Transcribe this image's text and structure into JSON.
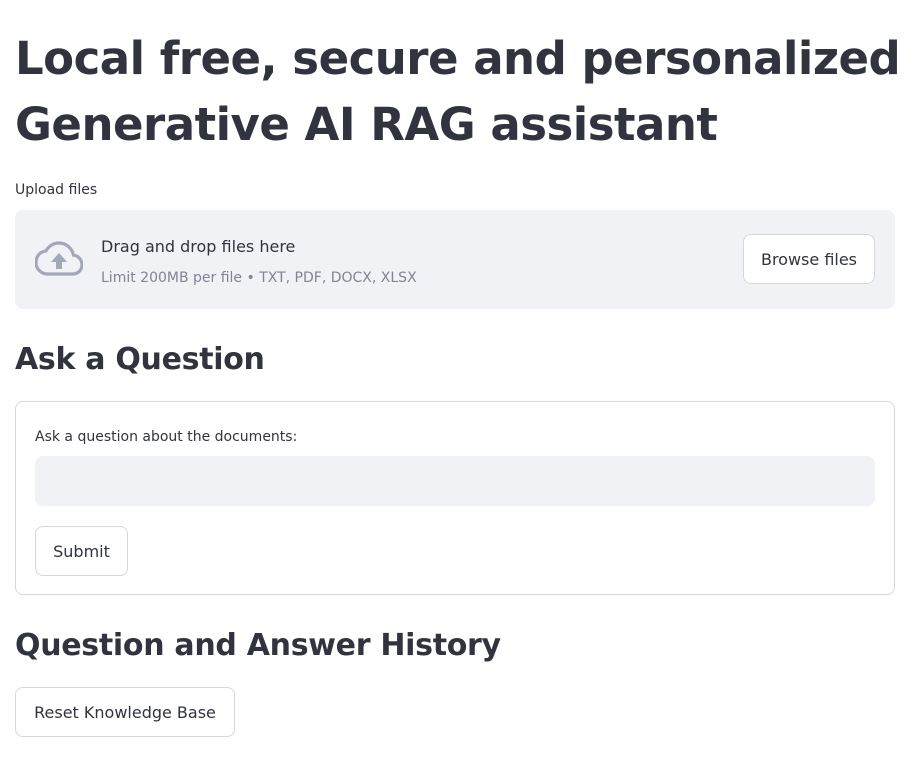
{
  "page": {
    "title": "Local free, secure and personalized Generative AI RAG assistant"
  },
  "uploader": {
    "label": "Upload files",
    "icon": "cloud-upload-icon",
    "drop_text": "Drag and drop files here",
    "limit_text": "Limit 200MB per file • TXT, PDF, DOCX, XLSX",
    "browse_label": "Browse files"
  },
  "ask": {
    "heading": "Ask a Question",
    "input_label": "Ask a question about the documents:",
    "input_value": "",
    "submit_label": "Submit"
  },
  "history": {
    "heading": "Question and Answer History",
    "reset_label": "Reset Knowledge Base"
  },
  "colors": {
    "text": "#31333f",
    "muted": "#808495",
    "panel_bg": "#f0f2f6",
    "border": "#d5d7de",
    "icon": "#a3a8b8"
  }
}
